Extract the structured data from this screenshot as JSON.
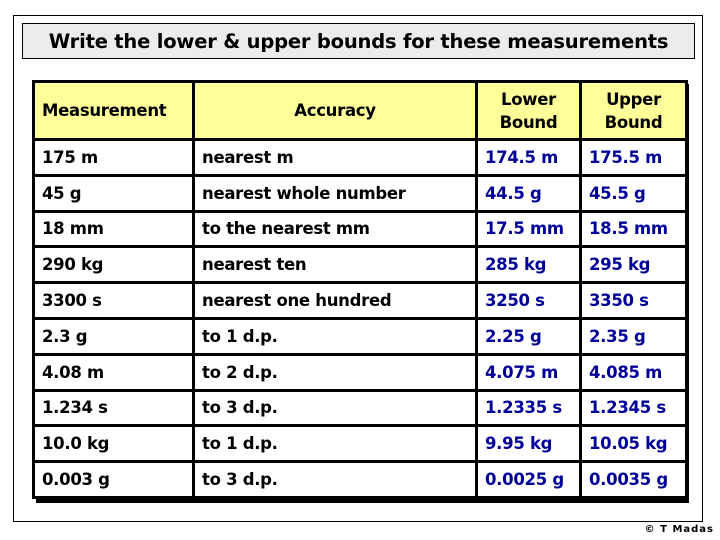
{
  "title": "Write the lower & upper bounds for these measurements",
  "table": {
    "headers": {
      "measurement": "Measurement",
      "accuracy": "Accuracy",
      "lower_line1": "Lower",
      "lower_line2": "Bound",
      "upper_line1": "Upper",
      "upper_line2": "Bound"
    },
    "rows": [
      {
        "measurement": "175 m",
        "accuracy": "nearest m",
        "lower": "174.5 m",
        "upper": "175.5 m"
      },
      {
        "measurement": "45 g",
        "accuracy": "nearest whole number",
        "lower": "44.5 g",
        "upper": "45.5 g"
      },
      {
        "measurement": "18 mm",
        "accuracy": "to the nearest mm",
        "lower": "17.5 mm",
        "upper": "18.5 mm"
      },
      {
        "measurement": "290 kg",
        "accuracy": "nearest ten",
        "lower": "285 kg",
        "upper": "295 kg"
      },
      {
        "measurement": "3300 s",
        "accuracy": "nearest one hundred",
        "lower": "3250 s",
        "upper": "3350 s"
      },
      {
        "measurement": "2.3 g",
        "accuracy": "to 1 d.p.",
        "lower": "2.25 g",
        "upper": "2.35 g"
      },
      {
        "measurement": "4.08 m",
        "accuracy": "to 2 d.p.",
        "lower": "4.075 m",
        "upper": "4.085 m"
      },
      {
        "measurement": "1.234 s",
        "accuracy": "to 3 d.p.",
        "lower": "1.2335 s",
        "upper": "1.2345 s"
      },
      {
        "measurement": "10.0 kg",
        "accuracy": "to 1 d.p.",
        "lower": "9.95 kg",
        "upper": "10.05 kg"
      },
      {
        "measurement": "0.003 g",
        "accuracy": "to 3 d.p.",
        "lower": "0.0025 g",
        "upper": "0.0035 g"
      }
    ]
  },
  "credit": "© T Madas",
  "colors": {
    "header_bg": "#ffff99",
    "answer_text": "#000099",
    "title_bg": "#ececec"
  }
}
